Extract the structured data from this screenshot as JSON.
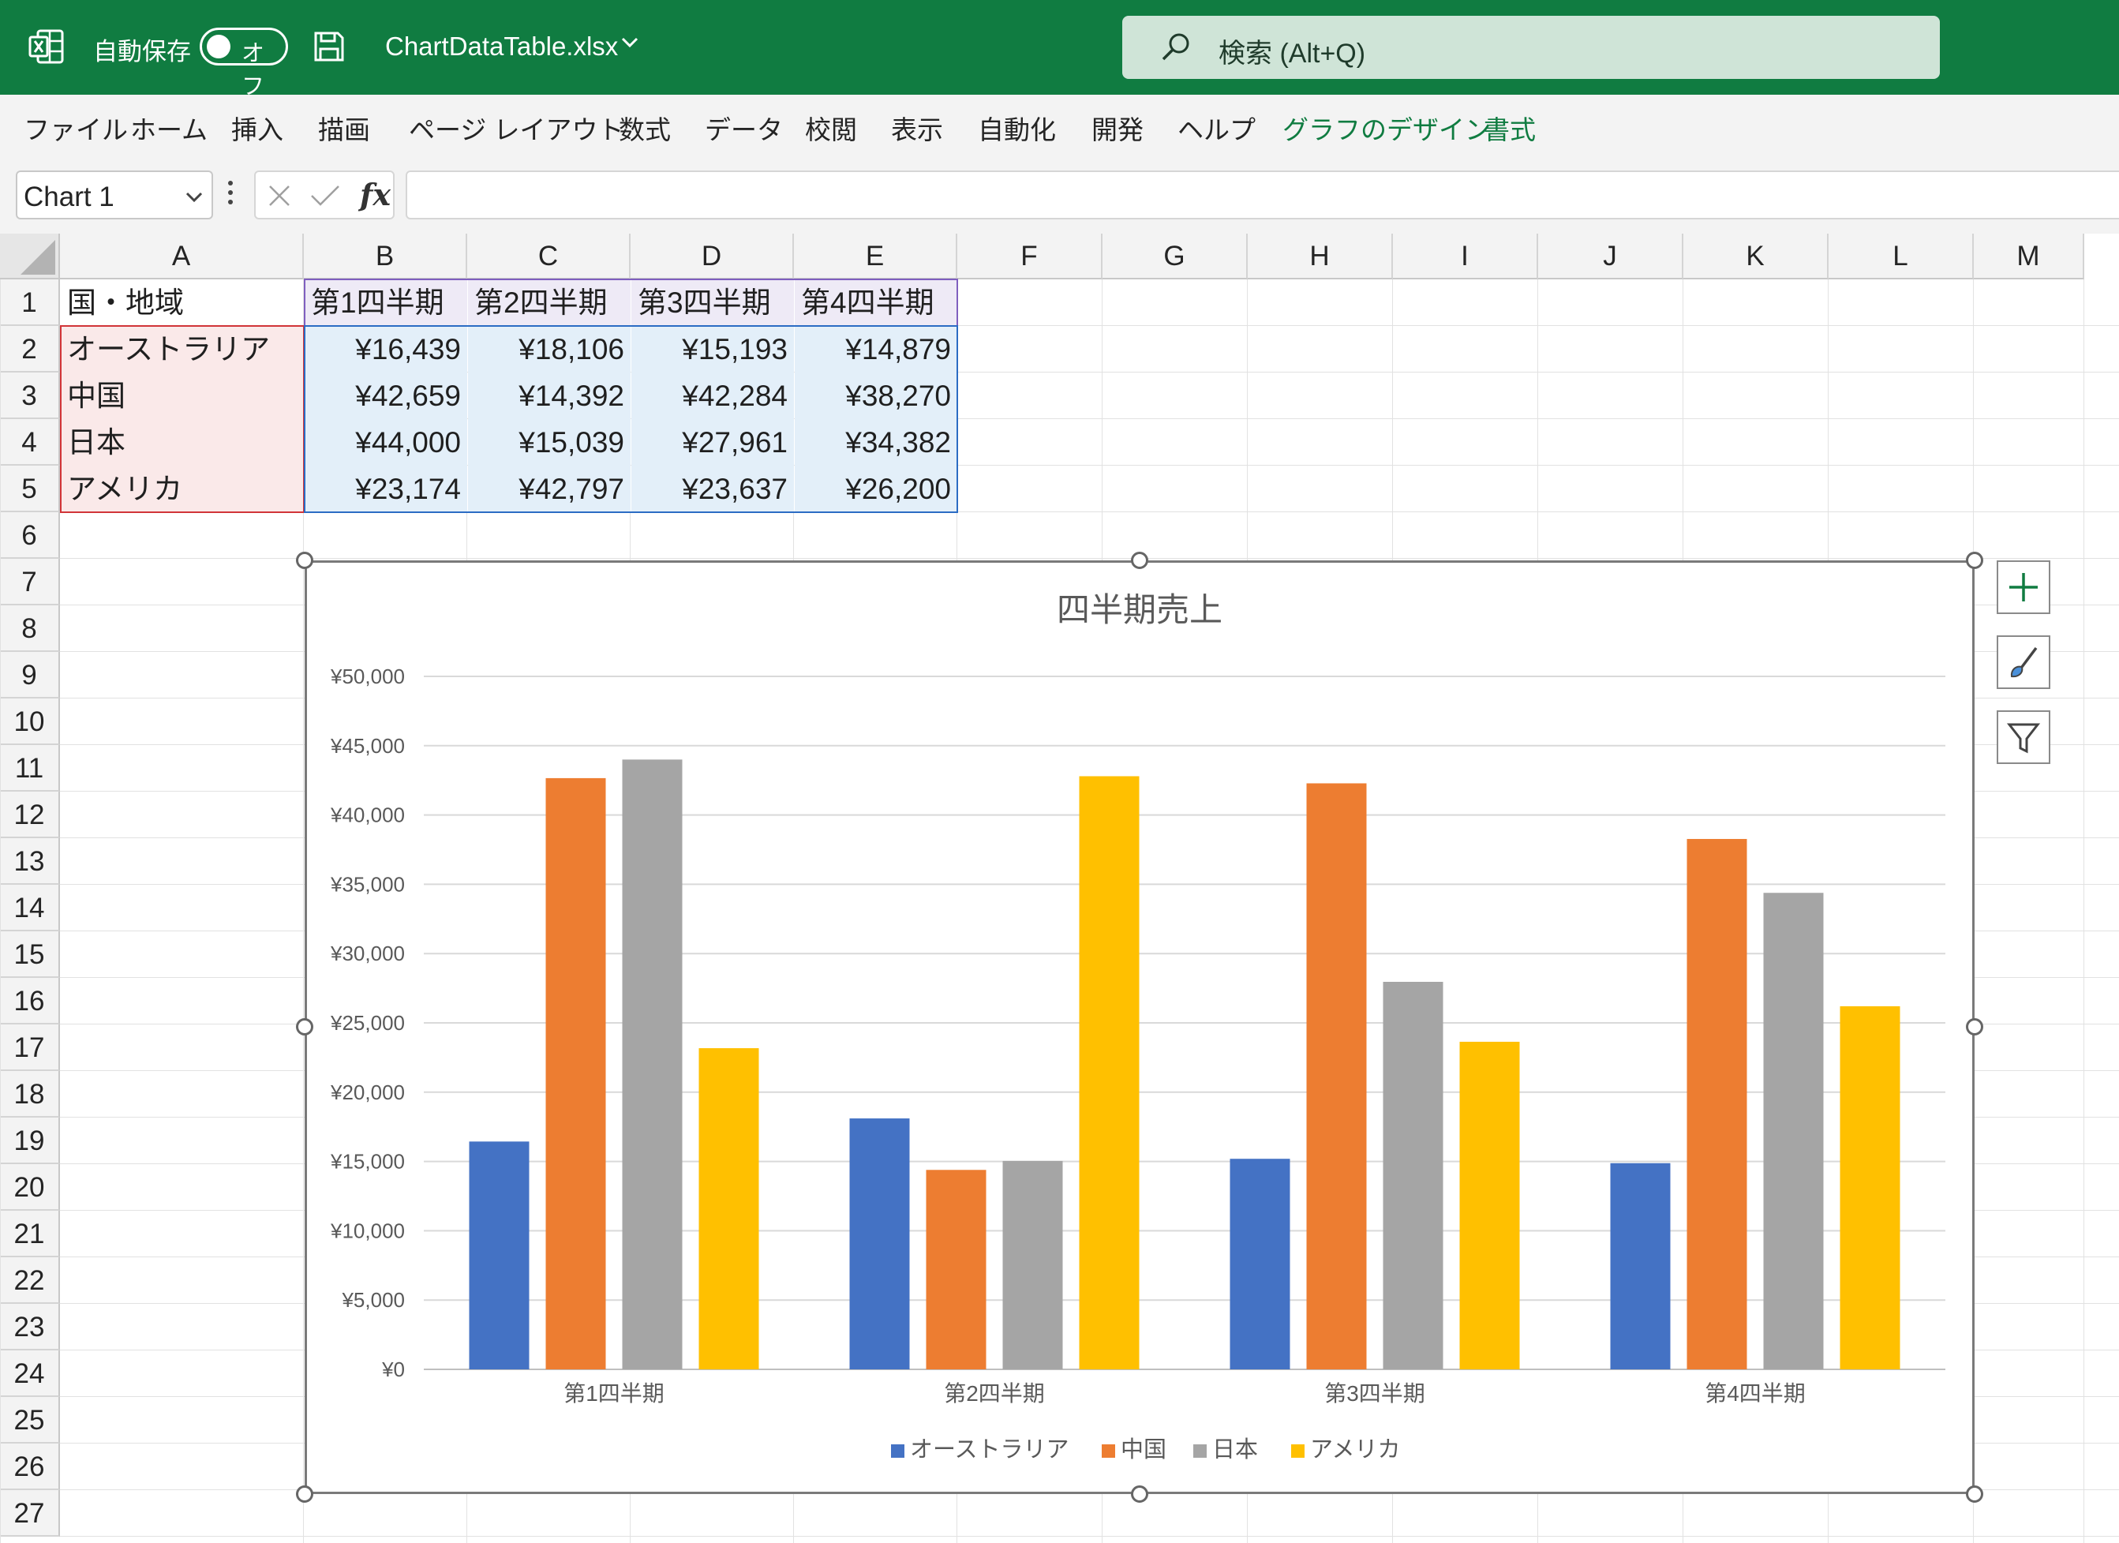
{
  "titlebar": {
    "autosave_label": "自動保存",
    "autosave_state": "オフ",
    "file_name": "ChartDataTable.xlsx",
    "search_placeholder": "検索 (Alt+Q)",
    "brand_color": "#107c41"
  },
  "ribbon": {
    "tabs": [
      {
        "label": "ファイル"
      },
      {
        "label": "ホーム"
      },
      {
        "label": "挿入"
      },
      {
        "label": "描画"
      },
      {
        "label": "ページ レイアウト"
      },
      {
        "label": "数式"
      },
      {
        "label": "データ"
      },
      {
        "label": "校閲"
      },
      {
        "label": "表示"
      },
      {
        "label": "自動化"
      },
      {
        "label": "開発"
      },
      {
        "label": "ヘルプ"
      },
      {
        "label": "グラフのデザイン"
      },
      {
        "label": "書式"
      }
    ]
  },
  "formula_bar": {
    "name_box": "Chart 1",
    "fx_label": "fx",
    "formula": ""
  },
  "sheet": {
    "columns": [
      "A",
      "B",
      "C",
      "D",
      "E",
      "F",
      "G",
      "H",
      "I",
      "J",
      "K",
      "L",
      "M"
    ],
    "rows": [
      "1",
      "2",
      "3",
      "4",
      "5",
      "6",
      "7",
      "8",
      "9",
      "10",
      "11",
      "12",
      "13",
      "14",
      "15",
      "16",
      "17",
      "18",
      "19",
      "20",
      "21",
      "22",
      "23",
      "24",
      "25",
      "26",
      "27"
    ],
    "header_row": [
      "国・地域",
      "第1四半期",
      "第2四半期",
      "第3四半期",
      "第4四半期"
    ],
    "data_rows": [
      [
        "オーストラリア",
        "¥16,439",
        "¥18,106",
        "¥15,193",
        "¥14,879"
      ],
      [
        "中国",
        "¥42,659",
        "¥14,392",
        "¥42,284",
        "¥38,270"
      ],
      [
        "日本",
        "¥44,000",
        "¥15,039",
        "¥27,961",
        "¥34,382"
      ],
      [
        "アメリカ",
        "¥23,174",
        "¥42,797",
        "¥23,637",
        "¥26,200"
      ]
    ]
  },
  "chart_data": {
    "type": "bar",
    "title": "四半期売上",
    "categories": [
      "第1四半期",
      "第2四半期",
      "第3四半期",
      "第4四半期"
    ],
    "series": [
      {
        "name": "オーストラリア",
        "color": "#4472c4",
        "values": [
          16439,
          18106,
          15193,
          14879
        ]
      },
      {
        "name": "中国",
        "color": "#ed7d31",
        "values": [
          42659,
          14392,
          42284,
          38270
        ]
      },
      {
        "name": "日本",
        "color": "#a5a5a5",
        "values": [
          44000,
          15039,
          27961,
          34382
        ]
      },
      {
        "name": "アメリカ",
        "color": "#ffc000",
        "values": [
          23174,
          42797,
          23637,
          26200
        ]
      }
    ],
    "ylim": [
      0,
      50000
    ],
    "y_ticks": [
      "¥0",
      "¥5,000",
      "¥10,000",
      "¥15,000",
      "¥20,000",
      "¥25,000",
      "¥30,000",
      "¥35,000",
      "¥40,000",
      "¥45,000",
      "¥50,000"
    ],
    "grid": true,
    "legend": "bottom"
  },
  "chart_tools": {
    "icons": [
      "plus-icon",
      "brush-icon",
      "filter-icon"
    ]
  }
}
